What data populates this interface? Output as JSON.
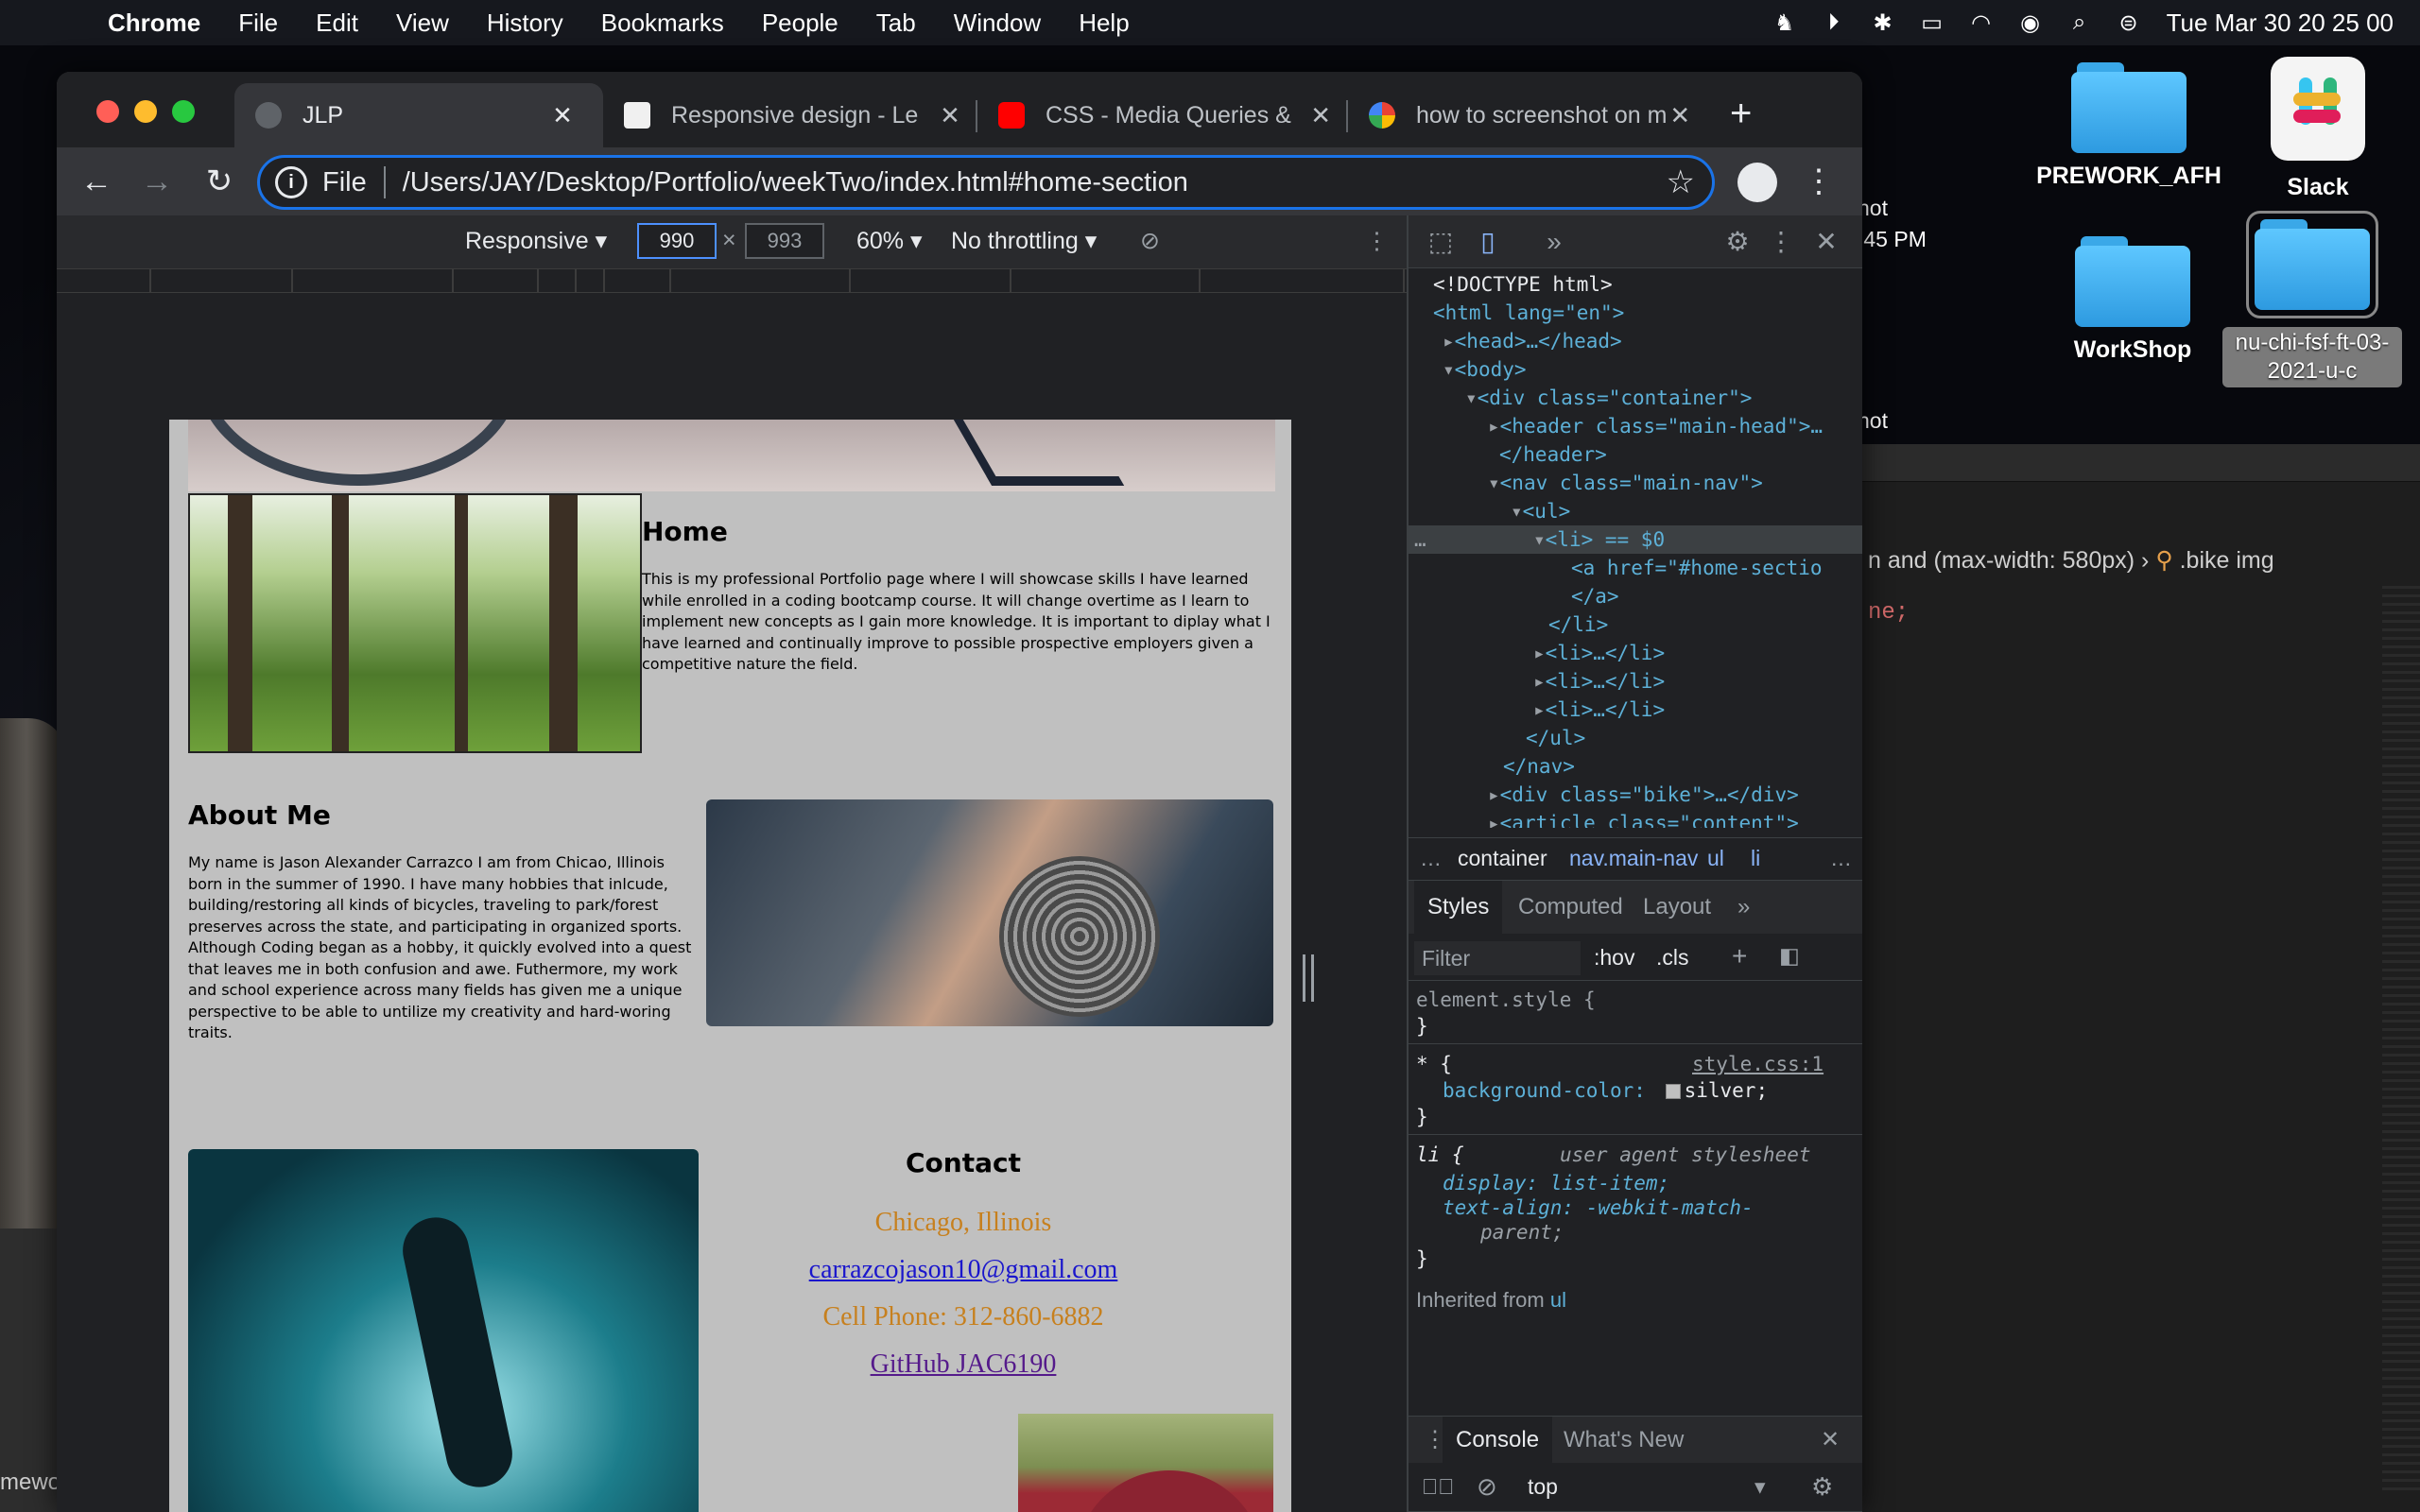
{
  "menubar": {
    "app_name": "Chrome",
    "menus": [
      "File",
      "Edit",
      "View",
      "History",
      "Bookmarks",
      "People",
      "Tab",
      "Window",
      "Help"
    ],
    "clock": "Tue Mar 30  20 25 00"
  },
  "desktop": {
    "icons": {
      "prework": "PREWORK_AFH",
      "slack": "Slack",
      "workshop": "WorkShop",
      "selected_folder": "nu-chi-fsf-ft-03-2021-u-c"
    },
    "bg_text_shot_1": "hot",
    "bg_text_time": ".45 PM",
    "bg_text_shot_2": "hot",
    "bg_editor_breadcrumb_prefix": "n and (max-width: 580px)",
    "bg_editor_breadcrumb_tag": ".bike img",
    "bg_editor_code": "ne;",
    "bg_left_text": "mewo"
  },
  "tabs": [
    {
      "title": "JLP",
      "active": true
    },
    {
      "title": "Responsive design - Le",
      "active": false
    },
    {
      "title": "CSS - Media Queries &",
      "active": false
    },
    {
      "title": "how to screenshot on m",
      "active": false
    }
  ],
  "toolbar": {
    "url_scheme": "File",
    "url": "/Users/JAY/Desktop/Portfolio/weekTwo/index.html#home-section"
  },
  "device_toolbar": {
    "mode": "Responsive",
    "width": "990",
    "height": "993",
    "zoom": "60%",
    "throttling": "No throttling"
  },
  "page": {
    "home_title": "Home",
    "home_text": "This is my professional Portfolio page where I will showcase skills I have learned while enrolled in a coding bootcamp course. It will change overtime as I learn to implement new concepts as I gain more knowledge. It is important to diplay what I have learned and continually improve to possible prospective employers given a competitive nature the field.",
    "about_title": "About Me",
    "about_text": "My name is Jason Alexander Carrazco I am from Chicao, Illinois born in the summer of 1990. I have many hobbies that inlcude, building/restoring all kinds of bicycles, traveling to park/forest preserves across the state, and participating in organized sports. Although Coding began as a hobby, it quickly evolved into a quest that leaves me in both confusion and awe. Futhermore, my work and school experience across many fields has given me a unique perspective to be able to untilize my creativity and hard-woring traits.",
    "contact_title": "Contact",
    "location": "Chicago, Illinois",
    "email": "carrazcojason10@gmail.com",
    "phone": "Cell Phone: 312-860-6882",
    "github": "GitHub JAC6190"
  },
  "devtools": {
    "dom": {
      "doctype": "<!DOCTYPE html>",
      "html_open": "<html lang=\"en\">",
      "head": "<head>…</head>",
      "body_open": "<body>",
      "container": "<div class=\"container\">",
      "header": "<header class=\"main-head\">…",
      "header_close": "</header>",
      "nav": "<nav class=\"main-nav\">",
      "ul": "<ul>",
      "li_selected": "<li> == $0",
      "a_href": "<a href=\"#home-sectio",
      "a_close": "</a>",
      "li_close": "</li>",
      "li_collapsed": "<li>…</li>",
      "ul_close": "</ul>",
      "nav_close": "</nav>",
      "bike": "<div class=\"bike\">…</div>",
      "article": "<article class=\"content\">"
    },
    "breadcrumbs": [
      "container",
      "nav.main-nav",
      "ul",
      "li"
    ],
    "style_tabs": [
      "Styles",
      "Computed",
      "Layout"
    ],
    "filter_placeholder": "Filter",
    "hov": ":hov",
    "cls": ".cls",
    "styles": {
      "element_style": "element.style {",
      "close_brace": "}",
      "universal_selector": "* {",
      "source": "style.css:1",
      "bg_prop": "background-color:",
      "bg_val": "silver;",
      "li_selector": "li {",
      "ua_label": "user agent stylesheet",
      "display_line": "display: list-item;",
      "text_align_line": "text-align: -webkit-match-",
      "text_align_cont": "parent;",
      "inherited_label": "Inherited from",
      "inherited_from": "ul"
    },
    "drawer_tabs": [
      "Console",
      "What's New"
    ],
    "console_context": "top"
  }
}
